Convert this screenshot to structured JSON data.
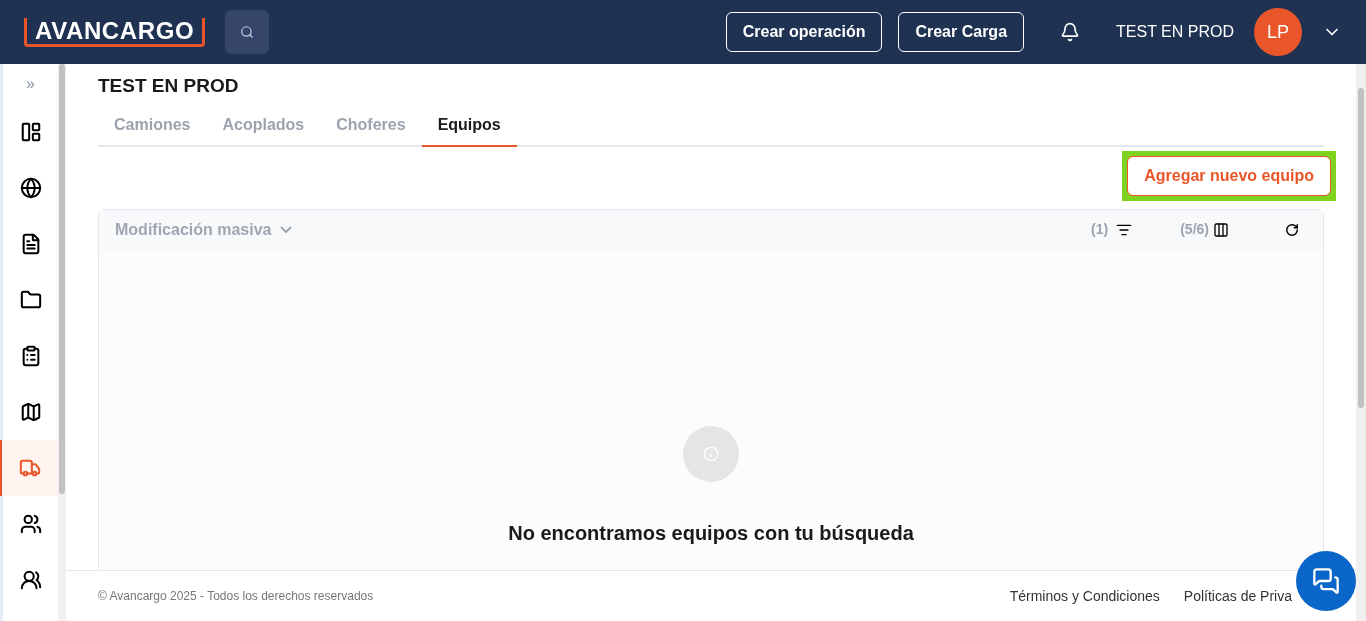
{
  "header": {
    "logo": "AVANCARGO",
    "buttons": [
      "Crear operación",
      "Crear Carga"
    ],
    "user_name": "TEST EN PROD",
    "avatar": "LP"
  },
  "sidebar": {
    "expand": "»",
    "items": [
      {
        "selected": false
      },
      {
        "selected": false
      },
      {
        "selected": false
      },
      {
        "selected": false
      },
      {
        "selected": false
      },
      {
        "selected": false
      },
      {
        "selected": true
      },
      {
        "selected": false
      },
      {
        "selected": false
      }
    ]
  },
  "page_title": "TEST EN PROD",
  "tabs": [
    {
      "label": "Camiones",
      "selected": false
    },
    {
      "label": "Acoplados",
      "selected": false
    },
    {
      "label": "Choferes",
      "selected": false
    },
    {
      "label": "Equipos",
      "selected": true
    }
  ],
  "add_button": {
    "label": "Agregar nuevo equipo",
    "highlighted": true
  },
  "table": {
    "bulk_edit": "Modificación masiva",
    "filter_count": "(1)",
    "columns_count": "(5/6)",
    "empty_message": "No encontramos equipos con tu búsqueda"
  },
  "footer": {
    "copyright": "© Avancargo 2025 - Todos los derechos reservados",
    "links": [
      "Términos y Condiciones",
      "Políticas de Priva"
    ]
  }
}
